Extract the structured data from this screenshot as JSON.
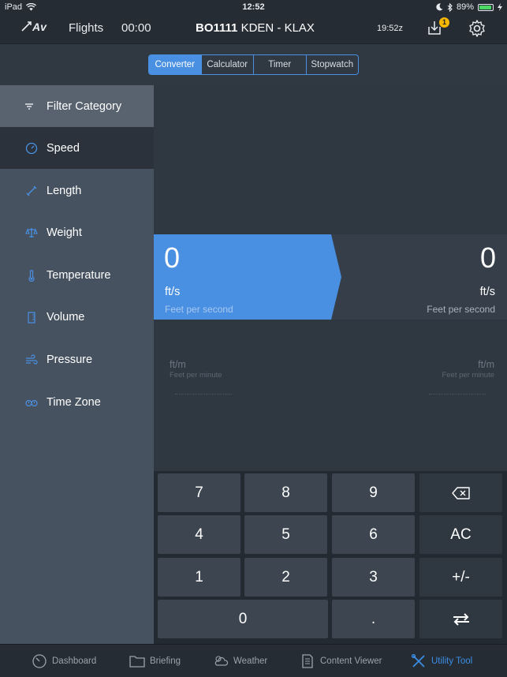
{
  "status": {
    "carrier": "iPad",
    "time": "12:52",
    "battery": "89%"
  },
  "nav": {
    "logo": "Av",
    "flights_label": "Flights",
    "timer": "00:00",
    "flight_number": "BO1111",
    "route": "KDEN - KLAX",
    "zulu_time": "19:52z",
    "download_badge": "1"
  },
  "segments": [
    "Converter",
    "Calculator",
    "Timer",
    "Stopwatch"
  ],
  "active_segment": "Converter",
  "sidebar": {
    "filter_label": "Filter Category",
    "items": [
      {
        "label": "Speed",
        "icon": "speedometer-icon"
      },
      {
        "label": "Length",
        "icon": "ruler-diagonal-icon"
      },
      {
        "label": "Weight",
        "icon": "scale-icon"
      },
      {
        "label": "Temperature",
        "icon": "thermometer-icon"
      },
      {
        "label": "Volume",
        "icon": "beaker-icon"
      },
      {
        "label": "Pressure",
        "icon": "wind-icon"
      },
      {
        "label": "Time Zone",
        "icon": "globe-icon"
      }
    ],
    "active": "Speed"
  },
  "converter": {
    "from": {
      "value": "0",
      "unit": "ft/s",
      "name": "Feet per second"
    },
    "to": {
      "value": "0",
      "unit": "ft/s",
      "name": "Feet per second"
    },
    "list": {
      "left": {
        "unit": "ft/m",
        "name": "Feet per minute"
      },
      "right": {
        "unit": "ft/m",
        "name": "Feet per minute"
      }
    }
  },
  "keypad": {
    "row1": [
      "7",
      "8",
      "9",
      "⌫"
    ],
    "row2": [
      "4",
      "5",
      "6",
      "AC"
    ],
    "row3": [
      "1",
      "2",
      "3",
      "+/-"
    ],
    "row4": [
      "0",
      ".",
      "⇄"
    ]
  },
  "tabs": [
    {
      "label": "Dashboard",
      "icon": "dashboard-gauge-icon"
    },
    {
      "label": "Briefing",
      "icon": "folder-icon"
    },
    {
      "label": "Weather",
      "icon": "weather-cloud-icon"
    },
    {
      "label": "Content Viewer",
      "icon": "document-icon"
    },
    {
      "label": "Utility Tool",
      "icon": "tools-icon"
    }
  ],
  "active_tab": "Utility Tool",
  "colors": {
    "accent": "#4a90e2",
    "sidebar": "#475260",
    "background": "#2b323b",
    "badge": "#f5b700"
  }
}
